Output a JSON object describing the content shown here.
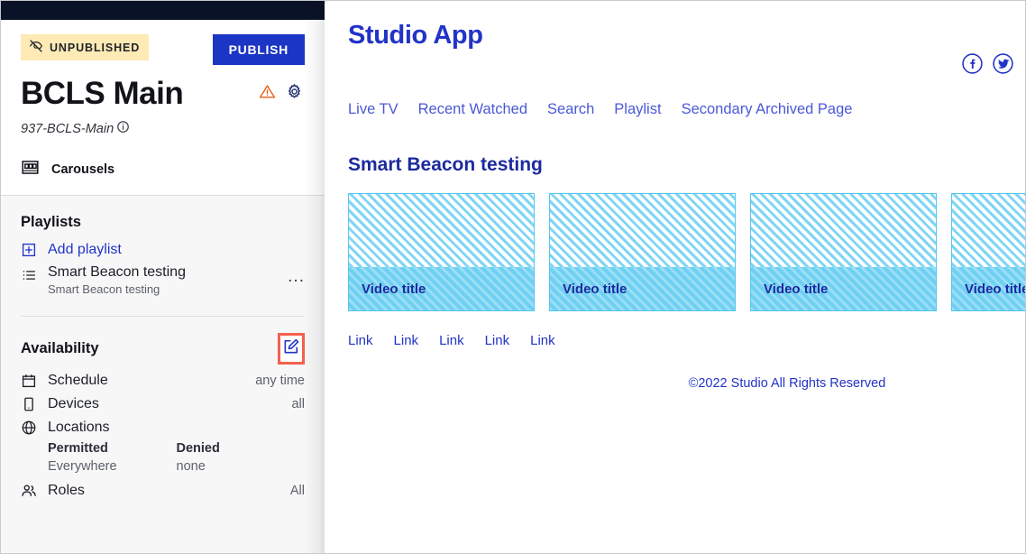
{
  "sidebar": {
    "status_badge": {
      "label": "UNPUBLISHED",
      "icon": "eye-off-icon",
      "bg_color": "#fdeab4"
    },
    "publish_button": {
      "label": "PUBLISH",
      "color": "#1b35c4"
    },
    "title": "BCLS Main",
    "subtitle": "937-BCLS-Main",
    "header_icons": [
      {
        "name": "warning-triangle-icon",
        "color": "#e8601c"
      },
      {
        "name": "gear-icon",
        "color": "#1b2a6b"
      }
    ],
    "carousels": {
      "label": "Carousels",
      "icon": "carousels-icon"
    },
    "playlists": {
      "heading": "Playlists",
      "add_label": "Add playlist",
      "items": [
        {
          "name": "Smart Beacon testing",
          "description": "Smart Beacon testing",
          "menu": "..."
        }
      ]
    },
    "availability": {
      "heading": "Availability",
      "edit_icon": "edit-pencil-icon",
      "highlight_color": "#f4604f",
      "rows": [
        {
          "icon": "calendar-icon",
          "label": "Schedule",
          "value": "any time"
        },
        {
          "icon": "device-phone-icon",
          "label": "Devices",
          "value": "all"
        },
        {
          "icon": "globe-icon",
          "label": "Locations",
          "value": ""
        }
      ],
      "locations": {
        "permitted_head": "Permitted",
        "permitted_value": "Everywhere",
        "denied_head": "Denied",
        "denied_value": "none"
      },
      "roles": {
        "icon": "users-icon",
        "label": "Roles",
        "value": "All"
      }
    }
  },
  "preview": {
    "app_title": "Studio App",
    "accent_color": "#2233c7",
    "social": [
      {
        "name": "facebook-icon",
        "glyph": "f"
      },
      {
        "name": "twitter-icon",
        "glyph": "twitter"
      }
    ],
    "nav": [
      {
        "label": "Live TV"
      },
      {
        "label": "Recent Watched"
      },
      {
        "label": "Search"
      },
      {
        "label": "Playlist"
      },
      {
        "label": "Secondary Archived Page"
      }
    ],
    "section_title": "Smart Beacon testing",
    "cards": [
      {
        "title": "Video title"
      },
      {
        "title": "Video title"
      },
      {
        "title": "Video title"
      },
      {
        "title": "Video title"
      }
    ],
    "links": [
      {
        "label": "Link"
      },
      {
        "label": "Link"
      },
      {
        "label": "Link"
      },
      {
        "label": "Link"
      },
      {
        "label": "Link"
      }
    ],
    "copyright": "©2022 Studio All Rights Reserved"
  }
}
